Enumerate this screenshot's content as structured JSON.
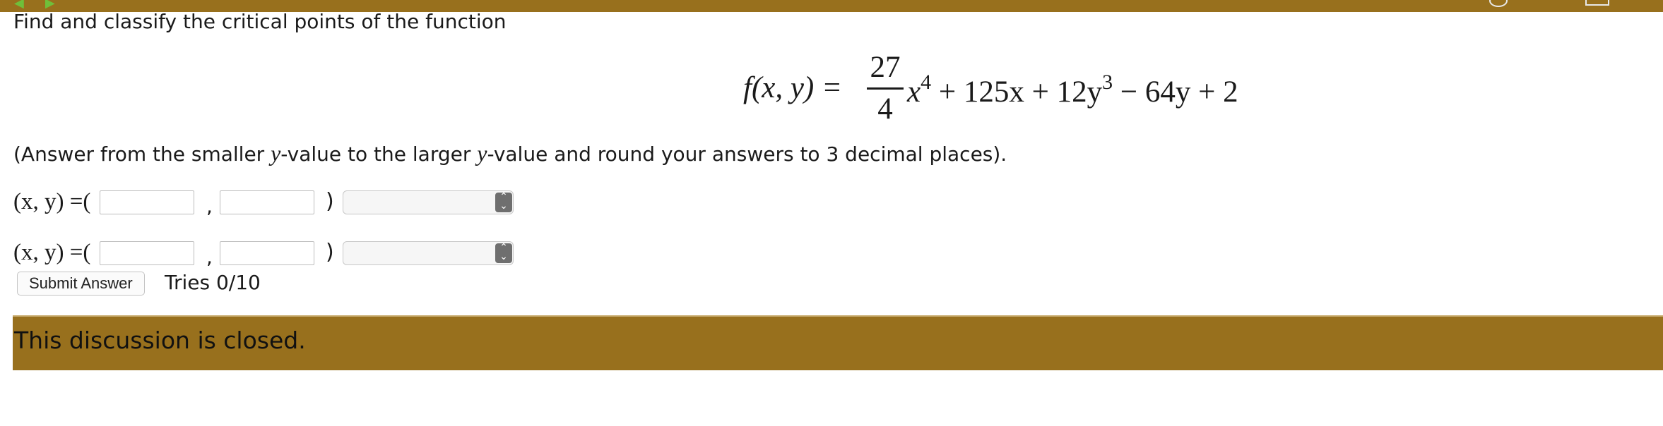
{
  "header": {
    "nav_icons": [
      "back-arrow-icon",
      "forward-arrow-icon"
    ],
    "color": "#98701d"
  },
  "problem": {
    "prompt": "Find and classify the critical points of the function",
    "formula": {
      "lhs": "f(x, y) =",
      "fraction_numerator": "27",
      "fraction_denominator": "4",
      "term1_var": "x",
      "term1_exp": "4",
      "term2": "+ 125x + 12y",
      "term2_exp": "3",
      "term3": "− 64y + 2"
    },
    "instruction": {
      "part1": "(Answer from the smaller ",
      "var": "y",
      "part2": "-value to the larger ",
      "part3": "-value and round your answers to 3 decimal places)."
    }
  },
  "answers": {
    "label": "(x, y) =(",
    "comma": ",",
    "close": ")",
    "rows": [
      {
        "x_value": "",
        "y_value": "",
        "classification": ""
      },
      {
        "x_value": "",
        "y_value": "",
        "classification": ""
      }
    ]
  },
  "controls": {
    "submit_label": "Submit Answer",
    "tries": "Tries 0/10"
  },
  "discussion": {
    "message": "This discussion is closed.",
    "color": "#98701d"
  }
}
